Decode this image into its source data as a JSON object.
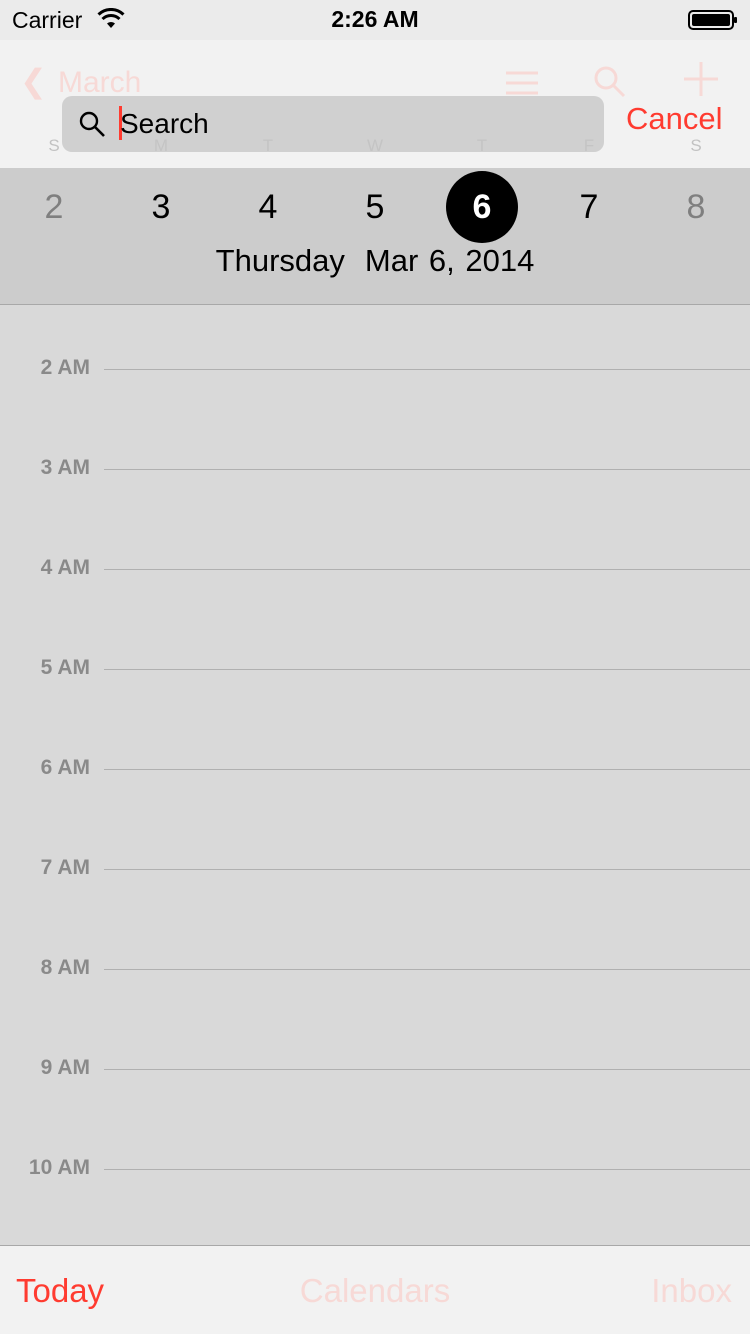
{
  "status_bar": {
    "carrier": "Carrier",
    "time": "2:26 AM",
    "icons": [
      "wifi-icon",
      "battery-icon"
    ]
  },
  "nav": {
    "back_label": "March",
    "weekday_letters": [
      "S",
      "M",
      "T",
      "W",
      "T",
      "F",
      "S"
    ],
    "icons": [
      "chevron-left-icon",
      "list-icon",
      "search-icon",
      "plus-icon"
    ]
  },
  "search": {
    "placeholder": "Search",
    "value": "",
    "cancel_label": "Cancel"
  },
  "week": {
    "days": [
      "2",
      "3",
      "4",
      "5",
      "6",
      "7",
      "8"
    ],
    "selected_index": 4,
    "selected_weekday": "Thursday",
    "selected_date": "Mar 6, 2014"
  },
  "timeline": {
    "hours": [
      "2 AM",
      "3 AM",
      "4 AM",
      "5 AM",
      "6 AM",
      "7 AM",
      "8 AM",
      "9 AM",
      "10 AM"
    ]
  },
  "tab_bar": {
    "today": "Today",
    "calendars": "Calendars",
    "inbox": "Inbox"
  },
  "colors": {
    "accent": "#ff3b30",
    "background": "#d9d9d9",
    "selected_day": "#000000"
  }
}
